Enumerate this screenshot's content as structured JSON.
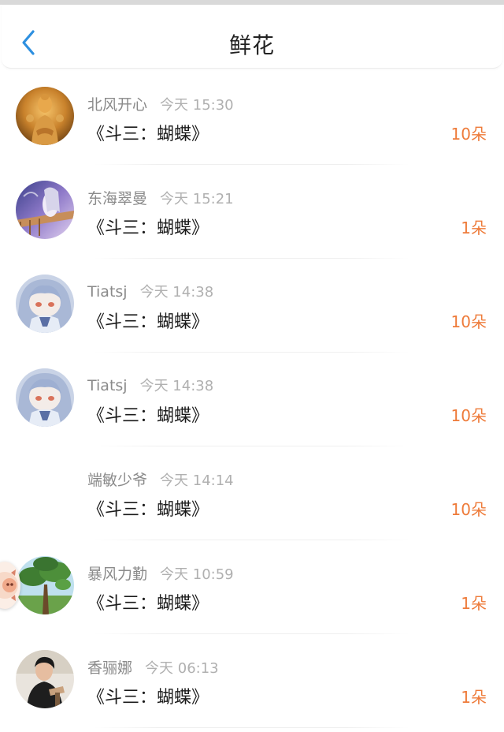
{
  "header": {
    "title": "鲜花",
    "back_icon": "chevron-left-icon",
    "accent": "#2e90e0"
  },
  "colors": {
    "count": "#ee7b3a",
    "name": "#8a8a8a",
    "time": "#b0b0b0"
  },
  "items": [
    {
      "name": "北风开心",
      "time": "今天 15:30",
      "content": "《斗三：蝴蝶》",
      "count": "10朵",
      "avatar": "buddha-statue-avatar"
    },
    {
      "name": "东海翠曼",
      "time": "今天 15:21",
      "content": "《斗三：蝴蝶》",
      "count": "1朵",
      "avatar": "anime-scene-avatar"
    },
    {
      "name": "Tiatsj",
      "time": "今天 14:38",
      "content": "《斗三：蝴蝶》",
      "count": "10朵",
      "avatar": "anime-girl-avatar"
    },
    {
      "name": "Tiatsj",
      "time": "今天 14:38",
      "content": "《斗三：蝴蝶》",
      "count": "10朵",
      "avatar": "anime-girl-avatar"
    },
    {
      "name": "端敏少爷",
      "time": "今天 14:14",
      "content": "《斗三：蝴蝶》",
      "count": "10朵",
      "avatar": ""
    },
    {
      "name": "暴风力勤",
      "time": "今天 10:59",
      "content": "《斗三：蝴蝶》",
      "count": "1朵",
      "avatar": "tree-sky-avatar"
    },
    {
      "name": "香骊娜",
      "time": "今天 06:13",
      "content": "《斗三：蝴蝶》",
      "count": "1朵",
      "avatar": "person-photo-avatar"
    }
  ]
}
